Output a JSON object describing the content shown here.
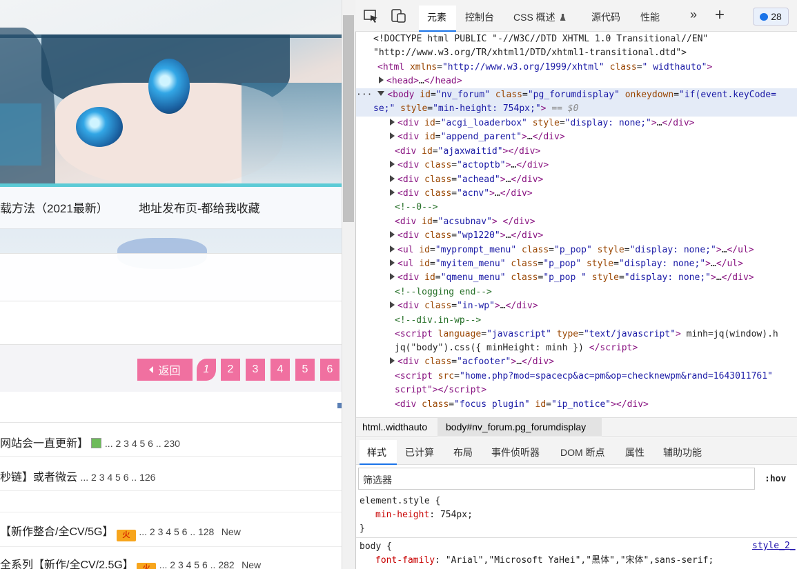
{
  "page": {
    "nav_items": [
      "载方法（2021最新）",
      "地址发布页-都给我收藏"
    ],
    "pager": {
      "back_label": "返回",
      "pages": [
        "1",
        "2",
        "3",
        "4",
        "5",
        "6"
      ]
    },
    "rows": [
      {
        "title": "网站会一直更新】",
        "pages": "... 2  3  4  5  6 .. 230",
        "badge": "",
        "suffix": ""
      },
      {
        "title": "秒链】或者微云",
        "pages": "... 2  3  4  5  6 .. 126",
        "badge": "",
        "suffix": ""
      },
      {
        "title": "【新作整合/全CV/5G】",
        "pages": "... 2  3  4  5  6 .. 128",
        "badge": "火",
        "suffix": "New"
      },
      {
        "title": "全系列【新作/全CV/2.5G】",
        "pages": "... 2  3  4  5  6 .. 282",
        "badge": "火",
        "suffix": "New"
      }
    ]
  },
  "devtools": {
    "tabs": [
      "元素",
      "控制台",
      "CSS 概述",
      "源代码",
      "性能"
    ],
    "issues_count": "28",
    "dom_lines": [
      {
        "indent": 25,
        "html": "<span class='tx'>&lt;!DOCTYPE html PUBLIC \"-//W3C//DTD XHTML 1.0 Transitional//EN\"</span>"
      },
      {
        "indent": 25,
        "html": "<span class='tx'>\"http://www.w3.org/TR/xhtml1/DTD/xhtml1-transitional.dtd\"&gt;</span>"
      },
      {
        "indent": 31,
        "html": "<span class='tg'>&lt;html</span> <span class='an'>xmlns</span>=<span class='av'>\"http://www.w3.org/1999/xhtml\"</span> <span class='an'>class</span>=<span class='av'>\" widthauto\"</span><span class='tg'>&gt;</span>"
      }
    ],
    "breadcrumbs": [
      "html..widthauto",
      "body#nv_forum.pg_forumdisplay"
    ],
    "subtabs": [
      "样式",
      "已计算",
      "布局",
      "事件侦听器",
      "DOM 断点",
      "属性",
      "辅助功能"
    ],
    "filter_placeholder": "筛选器",
    "hov_label": ":hov",
    "css_rules": {
      "element_selector": "element.style {",
      "element_prop": "min-height",
      "element_value": "754px;",
      "body_selector": "body {",
      "body_prop": "font-family",
      "body_value": "\"Arial\",\"Microsoft YaHei\",\"黑体\",\"宋体\",sans-serif;",
      "source_link": "style_2_"
    }
  }
}
